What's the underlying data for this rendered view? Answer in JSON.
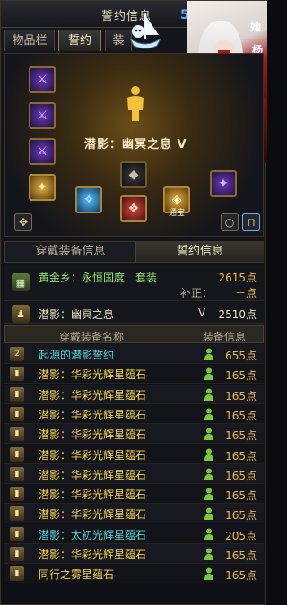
{
  "header": {
    "window_title": "誓约信息",
    "title_badge": "5",
    "tabs": [
      {
        "label": "物品栏",
        "active": false
      },
      {
        "label": "誓约",
        "active": true
      },
      {
        "label": "装",
        "active": false
      }
    ]
  },
  "art_glyphs": [
    "她",
    "杨",
    "她"
  ],
  "equipment": {
    "set_name": "潜影：幽冥之息 V",
    "badge_label": "通宝",
    "slot_icons": [
      "sword-icon",
      "sword-icon",
      "sword-icon",
      "sword-icon",
      "gem-icon",
      "gem-icon",
      "gem-icon",
      "gem-icon",
      "gem-icon",
      "gem-icon",
      "gem-icon"
    ]
  },
  "subtabs": [
    {
      "label": "穿戴装备信息",
      "active": false
    },
    {
      "label": "誓约信息",
      "active": true
    }
  ],
  "set_info": {
    "set_title": "黄金乡：永恒国度　套装",
    "set_points": "2615点",
    "correction_label": "补正：",
    "correction_value": "－点",
    "sub_name": "潜影：幽冥之息",
    "sub_grade": "V",
    "sub_points": "2510点"
  },
  "table": {
    "col_name": "穿戴装备名称",
    "col_info": "装备信息",
    "rows": [
      {
        "name": "起源的潜影誓约",
        "points": "655点",
        "color": "#52d6d6"
      },
      {
        "name": "潜影：华彩光辉星蕴石",
        "points": "165点",
        "color": "#f2d64a"
      },
      {
        "name": "潜影：华彩光辉星蕴石",
        "points": "165点",
        "color": "#f2d64a"
      },
      {
        "name": "潜影：华彩光辉星蕴石",
        "points": "165点",
        "color": "#f2d64a"
      },
      {
        "name": "潜影：华彩光辉星蕴石",
        "points": "165点",
        "color": "#f2d64a"
      },
      {
        "name": "潜影：华彩光辉星蕴石",
        "points": "165点",
        "color": "#f2d64a"
      },
      {
        "name": "潜影：华彩光辉星蕴石",
        "points": "165点",
        "color": "#f2d64a"
      },
      {
        "name": "潜影：华彩光辉星蕴石",
        "points": "165点",
        "color": "#f2d64a"
      },
      {
        "name": "潜影：华彩光辉星蕴石",
        "points": "165点",
        "color": "#f2d64a"
      },
      {
        "name": "潜影：太初光辉星蕴石",
        "points": "205点",
        "color": "#52d6d6"
      },
      {
        "name": "潜影：华彩光辉星蕴石",
        "points": "165点",
        "color": "#f2d64a"
      },
      {
        "name": "同行之雾星蕴石",
        "points": "165点",
        "color": "#f2d64a"
      }
    ]
  }
}
